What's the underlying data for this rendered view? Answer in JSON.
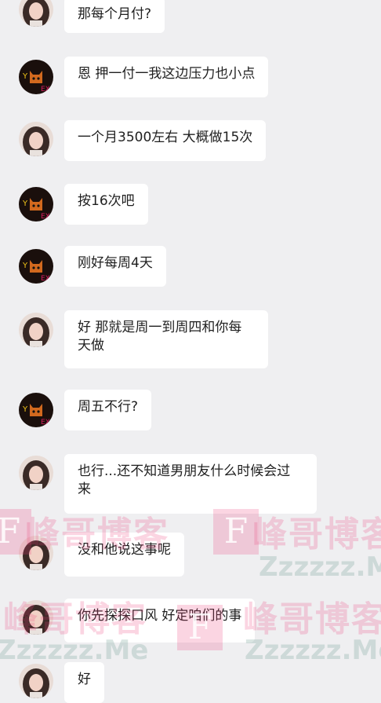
{
  "messages": [
    {
      "sender": "woman",
      "text": "那每个月付?"
    },
    {
      "sender": "cat",
      "text": "恩 押一付一我这边压力也小点"
    },
    {
      "sender": "woman",
      "text": "一个月3500左右 大概做15次"
    },
    {
      "sender": "cat",
      "text": "按16次吧"
    },
    {
      "sender": "cat",
      "text": "刚好每周4天"
    },
    {
      "sender": "woman",
      "text": "好 那就是周一到周四和你每天做"
    },
    {
      "sender": "cat",
      "text": "周五不行?"
    },
    {
      "sender": "woman",
      "text": "也行...还不知道男朋友什么时候会过来"
    },
    {
      "sender": "woman",
      "text": "没和他说这事呢"
    },
    {
      "sender": "woman",
      "text": "你先探探口风 好定咱们的事"
    },
    {
      "sender": "woman",
      "text": "好"
    }
  ],
  "watermark": {
    "text": "峰哥博客",
    "sub": "Zzzzzz.Me",
    "letter": "F"
  },
  "colors": {
    "background": "#efeff1",
    "bubble": "#ffffff",
    "text": "#1f1f1f",
    "watermark_pink": "#ec407a"
  }
}
